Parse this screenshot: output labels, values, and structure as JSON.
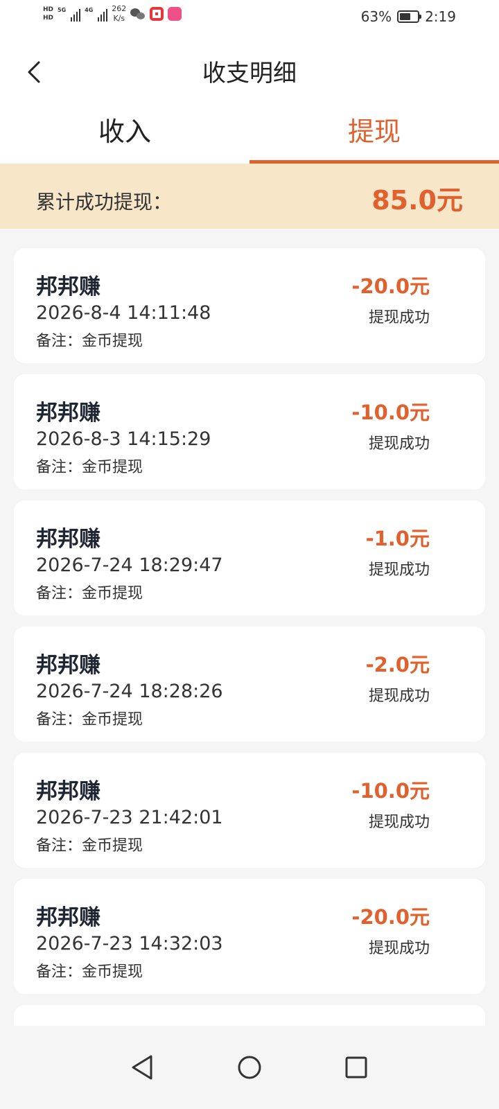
{
  "status_bar": {
    "hd_top": "HD",
    "hd_bottom": "HD",
    "net_1": "5G",
    "net_2": "4G",
    "speed_value": "262",
    "speed_unit": "K/s",
    "battery_percent": "63%",
    "battery_level": 0.63,
    "time": "2:19",
    "icons": [
      "wechat-icon",
      "red-app-icon",
      "pink-app-icon"
    ]
  },
  "header": {
    "title": "收支明细",
    "back_icon": "chevron-left-icon"
  },
  "tabs": [
    {
      "label": "收入",
      "active": false
    },
    {
      "label": "提现",
      "active": true
    }
  ],
  "summary": {
    "label": "累计成功提现：",
    "value": "85.0元"
  },
  "records": [
    {
      "app": "邦邦赚",
      "time": "2026-8-4 14:11:48",
      "note": "备注：金币提现",
      "amount": "-20.0元",
      "status": "提现成功"
    },
    {
      "app": "邦邦赚",
      "time": "2026-8-3 14:15:29",
      "note": "备注：金币提现",
      "amount": "-10.0元",
      "status": "提现成功"
    },
    {
      "app": "邦邦赚",
      "time": "2026-7-24 18:29:47",
      "note": "备注：金币提现",
      "amount": "-1.0元",
      "status": "提现成功"
    },
    {
      "app": "邦邦赚",
      "time": "2026-7-24 18:28:26",
      "note": "备注：金币提现",
      "amount": "-2.0元",
      "status": "提现成功"
    },
    {
      "app": "邦邦赚",
      "time": "2026-7-23 21:42:01",
      "note": "备注：金币提现",
      "amount": "-10.0元",
      "status": "提现成功"
    },
    {
      "app": "邦邦赚",
      "time": "2026-7-23 14:32:03",
      "note": "备注：金币提现",
      "amount": "-20.0元",
      "status": "提现成功"
    },
    {
      "app": "",
      "time": "",
      "note": "",
      "amount": "",
      "status": ""
    }
  ],
  "colors": {
    "accent": "#e0612e",
    "summary_bg": "#f8e6c8",
    "page_bg": "#f5f5f5"
  }
}
